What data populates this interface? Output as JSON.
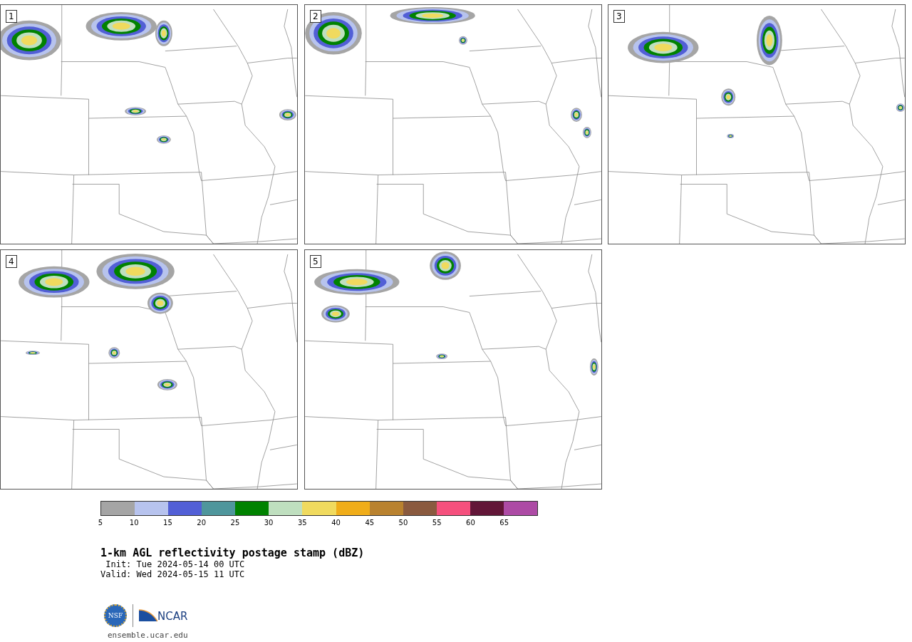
{
  "panels": [
    {
      "label": "1"
    },
    {
      "label": "2"
    },
    {
      "label": "3"
    },
    {
      "label": "4"
    },
    {
      "label": "5"
    }
  ],
  "colorbar": {
    "segments": [
      {
        "color": "#a5a5a5"
      },
      {
        "color": "#b7c3ee"
      },
      {
        "color": "#525fd6"
      },
      {
        "color": "#4f969c"
      },
      {
        "color": "#008200"
      },
      {
        "color": "#bfdfbf"
      },
      {
        "color": "#f0da5e"
      },
      {
        "color": "#f0ad19"
      },
      {
        "color": "#b9822f"
      },
      {
        "color": "#8a5a3f"
      },
      {
        "color": "#f5507d"
      },
      {
        "color": "#621638"
      },
      {
        "color": "#ad4ba5"
      }
    ],
    "ticks": [
      "5",
      "10",
      "15",
      "20",
      "25",
      "30",
      "35",
      "40",
      "45",
      "50",
      "55",
      "60",
      "65"
    ]
  },
  "title": "1-km AGL reflectivity postage stamp (dBZ)",
  "init": " Init: Tue 2024-05-14 00 UTC",
  "valid": "Valid: Wed 2024-05-15 11 UTC",
  "logo": {
    "nsf": "NSF",
    "ncar": "NCAR"
  },
  "link": "ensemble.ucar.edu"
}
